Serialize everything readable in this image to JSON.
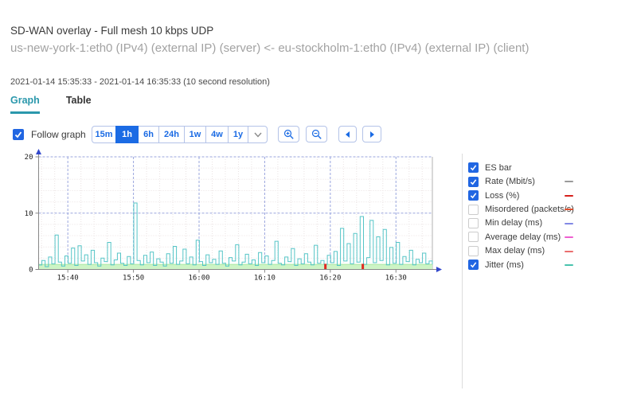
{
  "header": {
    "title": "SD-WAN overlay - Full mesh 10 kbps UDP",
    "subtitle": "us-new-york-1:eth0 (IPv4) (external IP) (server) <- eu-stockholm-1:eth0 (IPv4) (external IP) (client)",
    "period": "2021-01-14 15:35:33 - 2021-01-14 16:35:33 (10 second resolution)"
  },
  "tabs": [
    {
      "label": "Graph",
      "active": true
    },
    {
      "label": "Table",
      "active": false
    }
  ],
  "toolbar": {
    "follow_graph_label": "Follow graph",
    "follow_graph_checked": true,
    "ranges": [
      "15m",
      "1h",
      "6h",
      "24h",
      "1w",
      "4w",
      "1y"
    ],
    "active_range": "1h",
    "icon_buttons": [
      "zoom-in",
      "zoom-out",
      "pan-left",
      "pan-right"
    ]
  },
  "colors": {
    "accent_blue": "#1b6be4",
    "tab_teal": "#2b98ac",
    "grid_major": "#9aa6de",
    "grid_minor": "#eae2e2",
    "axis": "#888888",
    "axis_arrow": "#3348cc"
  },
  "chart_data": {
    "type": "line",
    "title": "",
    "x_window": [
      "2021-01-14 15:35:33",
      "2021-01-14 16:35:33"
    ],
    "resolution": "10 second",
    "ylim": [
      0,
      20
    ],
    "y_ticks": [
      0,
      10,
      20
    ],
    "y_major": [
      10,
      20
    ],
    "y_minor_step": 2,
    "x_minor_start_min": 0.45,
    "x_minor_step_min": 2,
    "x_ticks": [
      {
        "label": "15:40",
        "min": 4.45
      },
      {
        "label": "15:50",
        "min": 14.45
      },
      {
        "label": "16:00",
        "min": 24.45
      },
      {
        "label": "16:10",
        "min": 34.45
      },
      {
        "label": "16:20",
        "min": 44.45
      },
      {
        "label": "16:30",
        "min": 54.45
      }
    ],
    "series": [
      {
        "name": "ES bar",
        "type": "area",
        "color": "#cdf4c6",
        "edge_color": "#a9e79f",
        "height": 0.9,
        "visible": true
      },
      {
        "name": "Rate (Mbit/s)",
        "type": "line",
        "color": "#999999",
        "constant_value": 0.01,
        "visible": true
      },
      {
        "name": "Jitter (ms)",
        "type": "step-line",
        "color": "#55c5c7",
        "start_min": 0,
        "interval_min": 0.5,
        "visible": true,
        "values": [
          0.8,
          1.6,
          0.5,
          2.2,
          1.0,
          6.1,
          1.3,
          0.6,
          2.4,
          1.1,
          3.8,
          0.7,
          4.2,
          1.5,
          2.6,
          0.9,
          3.4,
          1.2,
          0.6,
          2.0,
          1.4,
          4.8,
          0.8,
          1.7,
          2.9,
          1.1,
          0.7,
          2.3,
          1.0,
          11.8,
          1.6,
          0.8,
          2.5,
          1.2,
          3.1,
          0.7,
          1.9,
          1.3,
          0.6,
          2.8,
          1.1,
          4.1,
          0.9,
          1.5,
          3.6,
          1.0,
          2.2,
          0.8,
          5.2,
          1.4,
          0.7,
          2.6,
          1.2,
          1.8,
          0.9,
          3.3,
          1.1,
          0.6,
          2.1,
          1.5,
          4.4,
          0.8,
          1.3,
          2.7,
          1.0,
          1.7,
          0.7,
          3.0,
          1.2,
          2.4,
          0.9,
          1.6,
          5.0,
          1.1,
          0.8,
          2.2,
          1.4,
          3.7,
          0.7,
          1.9,
          1.0,
          2.8,
          1.3,
          0.8,
          4.3,
          1.1,
          1.6,
          0.9,
          2.5,
          1.2,
          3.2,
          0.7,
          7.3,
          1.5,
          4.6,
          1.0,
          6.4,
          1.3,
          9.4,
          0.9,
          2.1,
          8.7,
          1.2,
          5.8,
          1.6,
          7.1,
          0.8,
          3.9,
          1.1,
          4.8,
          0.9,
          2.3,
          1.4,
          3.4,
          0.8,
          1.8,
          1.2,
          2.9,
          1.0,
          1.5,
          0.9
        ]
      },
      {
        "name": "Loss (%)",
        "type": "event-bars",
        "color": "#e02820",
        "event_minutes": [
          43.7,
          49.4
        ],
        "bar_height": 1.0,
        "visible": true
      }
    ]
  },
  "legend": {
    "items": [
      {
        "label": "ES bar",
        "checked": true,
        "swatch": null
      },
      {
        "label": "Rate (Mbit/s)",
        "checked": true,
        "swatch": "#9a9a9a"
      },
      {
        "label": "Loss (%)",
        "checked": true,
        "swatch": "#d6201c"
      },
      {
        "label": "Misordered (packets/s)",
        "checked": false,
        "swatch": "#e1502e"
      },
      {
        "label": "Min delay (ms)",
        "checked": false,
        "swatch": "#8289e5"
      },
      {
        "label": "Average delay (ms)",
        "checked": false,
        "swatch": "#ee5fd0"
      },
      {
        "label": "Max delay (ms)",
        "checked": false,
        "swatch": "#ea6e6e"
      },
      {
        "label": "Jitter (ms)",
        "checked": true,
        "swatch": "#49c3ae"
      }
    ]
  }
}
